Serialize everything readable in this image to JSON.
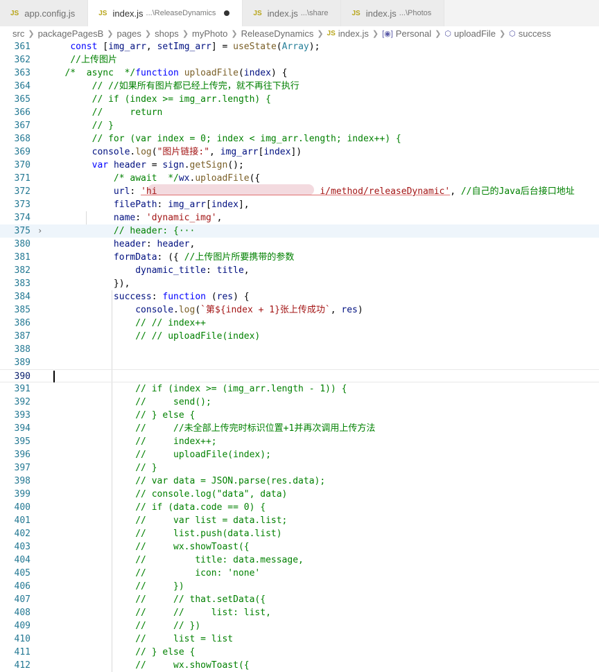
{
  "tabs": [
    {
      "badge": "JS",
      "label": "app.config.js",
      "suffix": "",
      "active": false,
      "modified": false
    },
    {
      "badge": "JS",
      "label": "index.js",
      "suffix": "...\\ReleaseDynamics",
      "active": true,
      "modified": true
    },
    {
      "badge": "JS",
      "label": "index.js",
      "suffix": "...\\share",
      "active": false,
      "modified": false
    },
    {
      "badge": "JS",
      "label": "index.js",
      "suffix": "...\\Photos",
      "active": false,
      "modified": false
    }
  ],
  "breadcrumb": [
    "src",
    "packagePagesB",
    "pages",
    "shops",
    "myPhoto",
    "ReleaseDynamics",
    "index.js",
    "Personal",
    "uploadFile",
    "success"
  ],
  "cursor_line": "390",
  "lines": [
    {
      "n": "361",
      "code": "    const [img_arr, setImg_arr] = useState(Array);"
    },
    {
      "n": "362",
      "code": "    //上传图片"
    },
    {
      "n": "363",
      "code": "   /*  async  */function uploadFile(index) {"
    },
    {
      "n": "364",
      "code": "        // //如果所有图片都已经上传完，就不再往下执行"
    },
    {
      "n": "365",
      "code": "        // if (index >= img_arr.length) {"
    },
    {
      "n": "366",
      "code": "        //     return"
    },
    {
      "n": "367",
      "code": "        // }"
    },
    {
      "n": "368",
      "code": "        // for (var index = 0; index < img_arr.length; index++) {"
    },
    {
      "n": "369",
      "code": "        console.log(\"图片链接:\", img_arr[index])"
    },
    {
      "n": "370",
      "code": "        var header = sign.getSign();"
    },
    {
      "n": "371",
      "code": "            /* await  */wx.uploadFile({"
    },
    {
      "n": "372",
      "code": "            url: 'hi                              i/method/releaseDynamic', //自己的Java后台接口地址"
    },
    {
      "n": "373",
      "code": "            filePath: img_arr[index],"
    },
    {
      "n": "374",
      "code": "            name: 'dynamic_img',"
    },
    {
      "n": "375",
      "code": "            // header: {···"
    },
    {
      "n": "380",
      "code": "            header: header,"
    },
    {
      "n": "381",
      "code": "            formData: ({ //上传图片所要携带的参数"
    },
    {
      "n": "382",
      "code": "                dynamic_title: title,"
    },
    {
      "n": "383",
      "code": "            }),"
    },
    {
      "n": "384",
      "code": "            success: function (res) {"
    },
    {
      "n": "385",
      "code": "                console.log(`第${index + 1}张上传成功`, res)"
    },
    {
      "n": "386",
      "code": "                // // index++"
    },
    {
      "n": "387",
      "code": "                // // uploadFile(index)"
    },
    {
      "n": "388",
      "code": ""
    },
    {
      "n": "389",
      "code": ""
    },
    {
      "n": "390",
      "code": ""
    },
    {
      "n": "391",
      "code": "                // if (index >= (img_arr.length - 1)) {"
    },
    {
      "n": "392",
      "code": "                //     send();"
    },
    {
      "n": "393",
      "code": "                // } else {"
    },
    {
      "n": "394",
      "code": "                //     //未全部上传完时标识位置+1并再次调用上传方法"
    },
    {
      "n": "395",
      "code": "                //     index++;"
    },
    {
      "n": "396",
      "code": "                //     uploadFile(index);"
    },
    {
      "n": "397",
      "code": "                // }"
    },
    {
      "n": "398",
      "code": "                // var data = JSON.parse(res.data);"
    },
    {
      "n": "399",
      "code": "                // console.log(\"data\", data)"
    },
    {
      "n": "400",
      "code": "                // if (data.code == 0) {"
    },
    {
      "n": "401",
      "code": "                //     var list = data.list;"
    },
    {
      "n": "402",
      "code": "                //     list.push(data.list)"
    },
    {
      "n": "403",
      "code": "                //     wx.showToast({"
    },
    {
      "n": "404",
      "code": "                //         title: data.message,"
    },
    {
      "n": "405",
      "code": "                //         icon: 'none'"
    },
    {
      "n": "406",
      "code": "                //     })"
    },
    {
      "n": "407",
      "code": "                //     // that.setData({"
    },
    {
      "n": "408",
      "code": "                //     //     list: list,"
    },
    {
      "n": "409",
      "code": "                //     // })"
    },
    {
      "n": "410",
      "code": "                //     list = list"
    },
    {
      "n": "411",
      "code": "                // } else {"
    },
    {
      "n": "412",
      "code": "                //     wx.showToast({"
    }
  ],
  "colors": {
    "keyword": "#0000ff",
    "comment": "#008000",
    "string": "#a31515",
    "variable": "#001080",
    "function": "#795e26",
    "type": "#267f99",
    "line_number": "#237893"
  }
}
